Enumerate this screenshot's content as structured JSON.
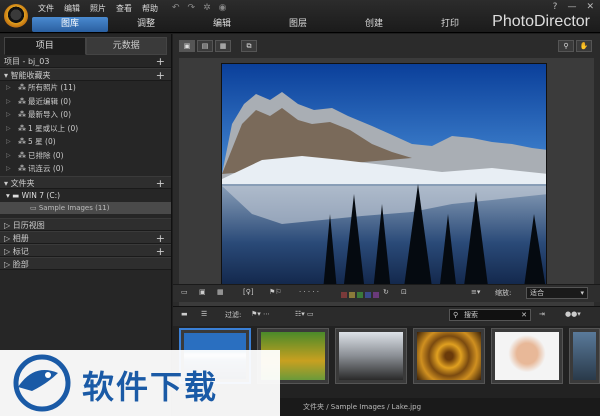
{
  "app": {
    "brand": "PhotoDirector"
  },
  "menu": [
    "文件",
    "编辑",
    "照片",
    "查看",
    "帮助"
  ],
  "window_controls": [
    "?",
    "—",
    "✕"
  ],
  "main_tabs": [
    "图库",
    "调整",
    "编辑",
    "图层",
    "创建",
    "打印"
  ],
  "active_tab": "图库",
  "panel_tabs": [
    "项目",
    "元数据"
  ],
  "project": "项目 - bj_03",
  "smart_collections_title": "智能收藏夹",
  "smart_collections": [
    {
      "icon": "all-photos-icon",
      "label": "所有照片 (11)"
    },
    {
      "icon": "recent-edit-icon",
      "label": "最近编辑 (0)"
    },
    {
      "icon": "recent-import-icon",
      "label": "最新导入 (0)"
    },
    {
      "icon": "one-star-icon",
      "label": "1 星或以上 (0)"
    },
    {
      "icon": "five-star-icon",
      "label": "5 星 (0)"
    },
    {
      "icon": "rejected-icon",
      "label": "已排除 (0)"
    },
    {
      "icon": "cloud-icon",
      "label": "讯连云 (0)"
    }
  ],
  "folders_title": "文件夹",
  "drive": "WIN 7 (C:)",
  "folder_selected": "Sample Images (11)",
  "sections": [
    "日历视图",
    "相册",
    "标记",
    "脸部"
  ],
  "zoom": {
    "label": "缩放:",
    "value": "适合"
  },
  "filter": {
    "label": "过滤:",
    "search_placeholder": "搜索"
  },
  "status_path": "文件夹 / Sample Images / Lake.jpg",
  "colors": {
    "accent": "#3a7fd5",
    "panel": "#262626"
  },
  "watermark_text": "软件下载"
}
